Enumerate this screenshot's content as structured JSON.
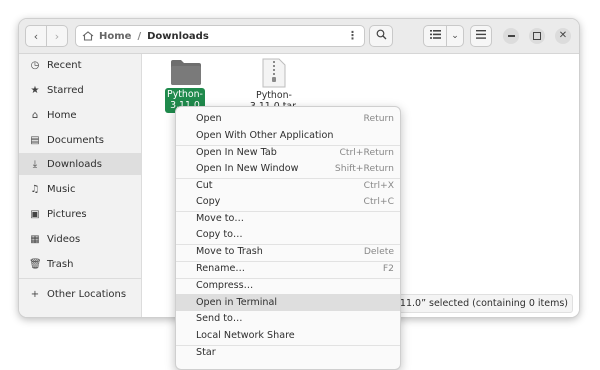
{
  "header": {
    "home_label": "Home",
    "separator": "/",
    "current_label": "Downloads"
  },
  "sidebar": {
    "items": [
      {
        "label": "Recent",
        "icon": "clock-icon"
      },
      {
        "label": "Starred",
        "icon": "star-icon"
      },
      {
        "label": "Home",
        "icon": "home-icon"
      },
      {
        "label": "Documents",
        "icon": "document-icon"
      },
      {
        "label": "Downloads",
        "icon": "download-icon"
      },
      {
        "label": "Music",
        "icon": "music-icon"
      },
      {
        "label": "Pictures",
        "icon": "picture-icon"
      },
      {
        "label": "Videos",
        "icon": "video-icon"
      },
      {
        "label": "Trash",
        "icon": "trash-icon"
      }
    ],
    "other_locations": "Other Locations"
  },
  "files": [
    {
      "name_line1": "Python-",
      "name_line2": "3.11.0",
      "type": "folder",
      "selected": true
    },
    {
      "name_line1": "Python-",
      "name_line2": "3.11.0.tar.",
      "type": "archive",
      "selected": false
    }
  ],
  "status": {
    "text": "on-3.11.0” selected  (containing 0 items)"
  },
  "menu": {
    "items": [
      {
        "label": "Open",
        "shortcut": "Return"
      },
      {
        "label": "Open With Other Application",
        "shortcut": ""
      },
      {
        "label": "Open In New Tab",
        "shortcut": "Ctrl+Return"
      },
      {
        "label": "Open In New Window",
        "shortcut": "Shift+Return"
      },
      {
        "label": "Cut",
        "shortcut": "Ctrl+X"
      },
      {
        "label": "Copy",
        "shortcut": "Ctrl+C"
      },
      {
        "label": "Move to…",
        "shortcut": ""
      },
      {
        "label": "Copy to…",
        "shortcut": ""
      },
      {
        "label": "Move to Trash",
        "shortcut": "Delete"
      },
      {
        "label": "Rename…",
        "shortcut": "F2"
      },
      {
        "label": "Compress…",
        "shortcut": ""
      },
      {
        "label": "Open in Terminal",
        "shortcut": ""
      },
      {
        "label": "Send to…",
        "shortcut": ""
      },
      {
        "label": "Local Network Share",
        "shortcut": ""
      },
      {
        "label": "Star",
        "shortcut": ""
      }
    ]
  },
  "colors": {
    "selection": "#1f8a4c",
    "folder": "#6e6e6e",
    "menu_highlight": "#dedede"
  }
}
